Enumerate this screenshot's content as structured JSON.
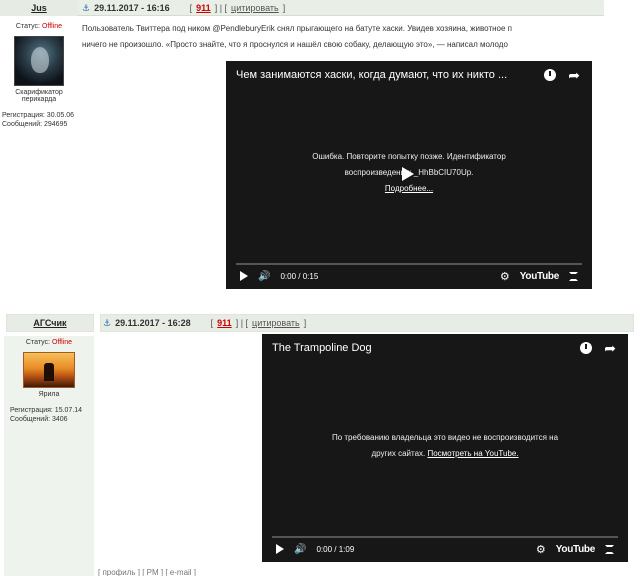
{
  "post1": {
    "author": "Jus",
    "date": "29.11.2017 - 16:16",
    "post_number": "911",
    "cite_label": "цитировать",
    "status_label": "Статус:",
    "status_value": "Offline",
    "avatar_caption": "Скарификатор перикарда",
    "registration": "Регистрация: 30.05.06",
    "messages": "Сообщений: 294695",
    "text_line1": "Пользователь Твиттера под ником @PendleburyErik снял прыгающего на батуте хаски. Увидев хозяина, животное п",
    "text_line2": "ничего не произошло. «Просто знайте, что я проснулся и нашёл свою собаку, делающую это», — написал молодо",
    "video": {
      "title": "Чем занимаются хаски, когда думают, что их никто ...",
      "message_line1": "Ошибка. Повторите попытку позже. Идентификатор",
      "message_line2": "воспроизведения: _HhBbCIU70Up.",
      "link": "Подробнее...",
      "time": "0:00 / 0:15",
      "brand": "YouTube"
    }
  },
  "post2": {
    "author": "АГСчик",
    "date": "29.11.2017 - 16:28",
    "post_number": "911",
    "cite_label": "цитировать",
    "status_label": "Статус:",
    "status_value": "Offline",
    "avatar_caption": "Ярила",
    "registration": "Регистрация: 15.07.14",
    "messages": "Сообщений: 3406",
    "video": {
      "title": "The Trampoline Dog",
      "message_line1": "По требованию владельца это видео не воспроизводится на",
      "message_line2": "других сайтах.",
      "link": "Посмотреть на YouTube.",
      "time": "0:00 / 1:09",
      "brand": "YouTube"
    }
  },
  "footer_fragment": "[ профиль ] [ PM ] [ e-mail ]",
  "colors": {
    "header_bg": "#e9efe7",
    "offline": "#cc0000",
    "post_number": "#cc0000",
    "video_bg": "#171717"
  }
}
